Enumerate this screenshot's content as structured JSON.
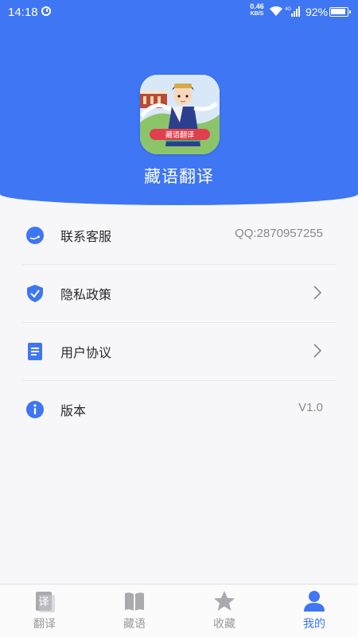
{
  "status_bar": {
    "time": "14:18",
    "net_speed": "0.46",
    "net_unit": "KB/S",
    "network": "4G",
    "battery": "92%"
  },
  "header": {
    "logo_badge": "藏语翻译",
    "app_name": "藏语翻译"
  },
  "menu": [
    {
      "icon": "headset-icon",
      "label": "联系客服",
      "value": "QQ:2870957255",
      "arrow": false
    },
    {
      "icon": "shield-check-icon",
      "label": "隐私政策",
      "value": "",
      "arrow": true
    },
    {
      "icon": "document-icon",
      "label": "用户协议",
      "value": "",
      "arrow": true
    },
    {
      "icon": "info-icon",
      "label": "版本",
      "value": "V1.0",
      "arrow": false
    }
  ],
  "tabs": [
    {
      "icon": "translate-icon",
      "label": "翻译",
      "active": false
    },
    {
      "icon": "book-icon",
      "label": "藏语",
      "active": false
    },
    {
      "icon": "star-icon",
      "label": "收藏",
      "active": false
    },
    {
      "icon": "user-icon",
      "label": "我的",
      "active": true
    }
  ],
  "colors": {
    "primary": "#3f76f3",
    "tab_inactive": "#9a9a9a",
    "background": "#f7f7f9"
  }
}
